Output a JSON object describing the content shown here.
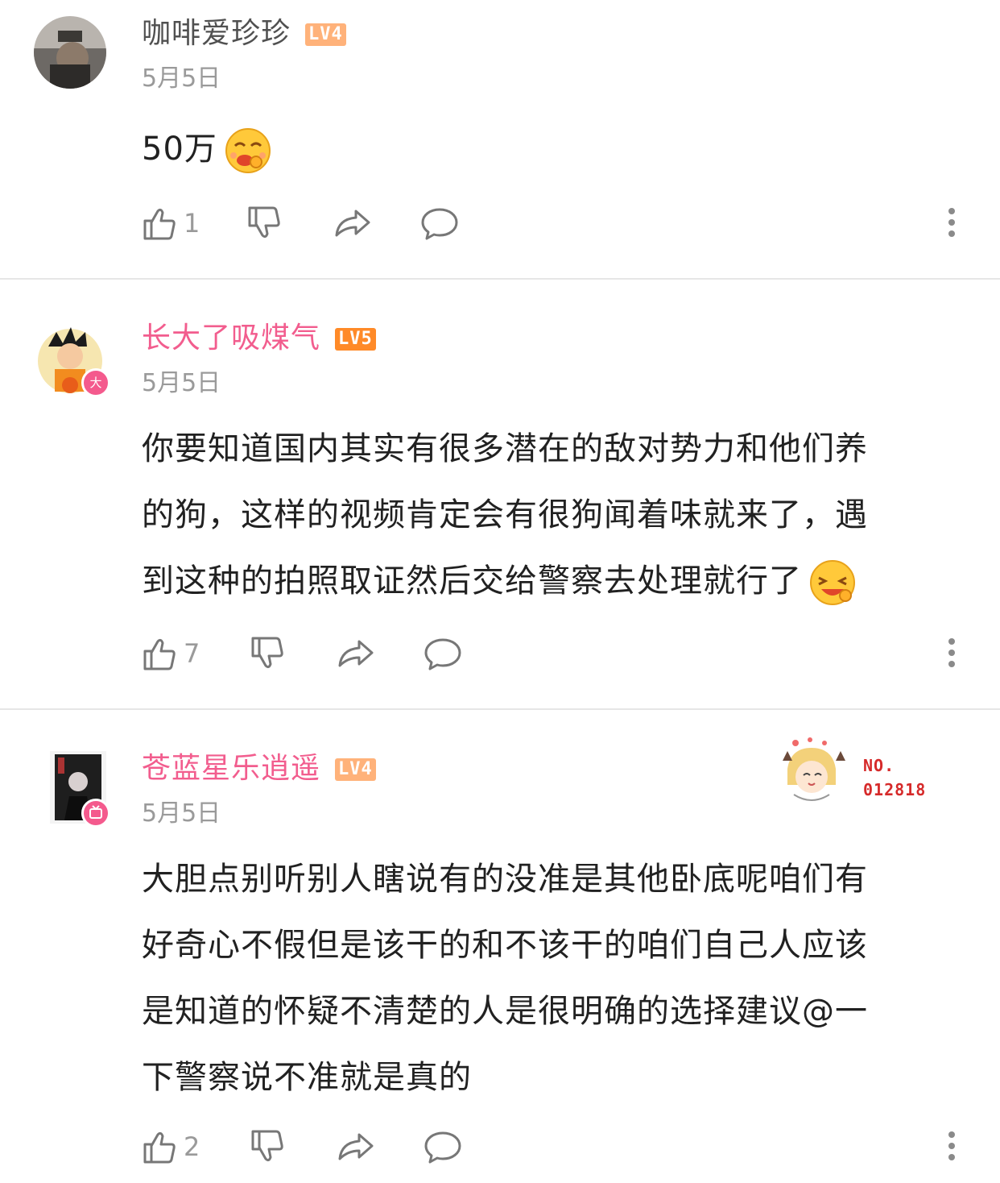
{
  "colors": {
    "vip_name": "#f25d8e",
    "plain_name": "#505050",
    "lv4": "#ffb27a",
    "lv5": "#ff8a28",
    "medal_text": "#d62a2a"
  },
  "comments": [
    {
      "username": "咖啡爱珍珍",
      "level": "LV4",
      "date": "5月5日",
      "text": "50万",
      "emoji": "laughing-cover-mouth-emoji",
      "likes": "1"
    },
    {
      "username": "长大了吸煤气",
      "level": "LV5",
      "date": "5月5日",
      "avatar_badge": "大",
      "lines": [
        "你要知道国内其实有很多潜在的敌对势力和他们养",
        "的狗，这样的视频肯定会有很狗闻着味就来了，遇",
        "到这种的拍照取证然后交给警察去处理就行了"
      ],
      "emoji": "laughing-emoji",
      "likes": "7"
    },
    {
      "username": "苍蓝星乐逍遥",
      "level": "LV4",
      "date": "5月5日",
      "medal_line1": "NO.",
      "medal_line2": "012818",
      "lines": [
        "大胆点别听别人瞎说有的没准是其他卧底呢咱们有",
        "好奇心不假但是该干的和不该干的咱们自己人应该",
        "是知道的怀疑不清楚的人是很明确的选择建议@一",
        "下警察说不准就是真的"
      ],
      "likes": "2"
    }
  ]
}
